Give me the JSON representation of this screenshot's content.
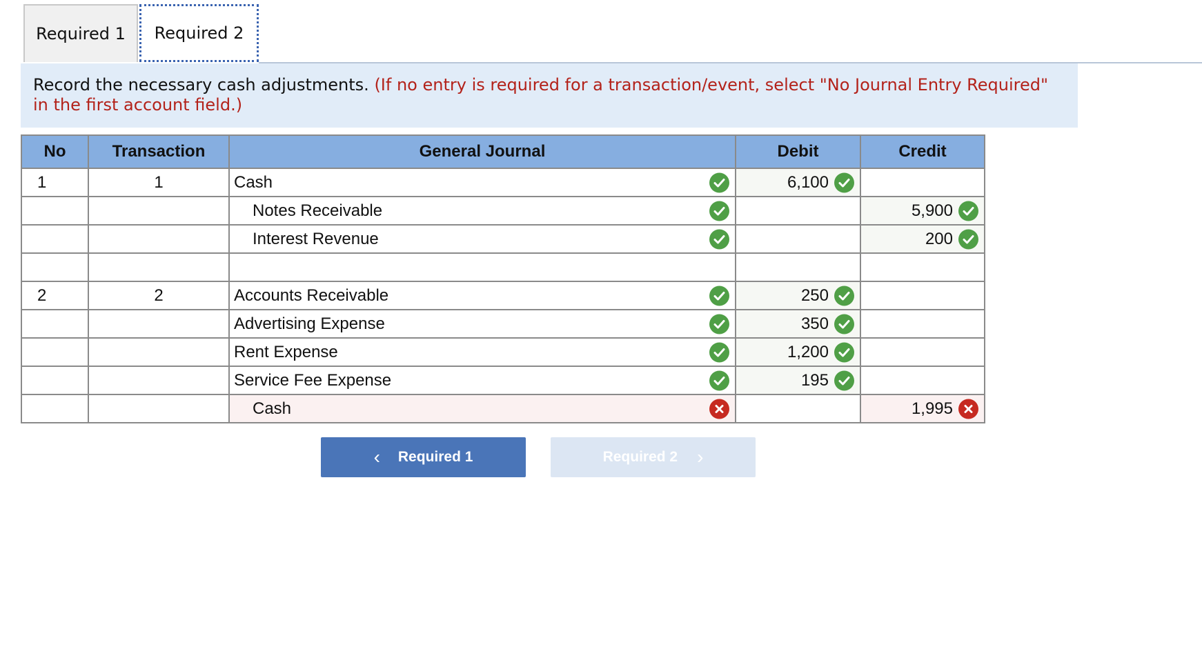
{
  "tabs": [
    {
      "label": "Required 1"
    },
    {
      "label": "Required 2"
    }
  ],
  "instructions": {
    "main": "Record the necessary cash adjustments.",
    "note": "(If no entry is required for a transaction/event, select \"No Journal Entry Required\" in the first account field.)"
  },
  "table": {
    "headers": {
      "no": "No",
      "transaction": "Transaction",
      "journal": "General Journal",
      "debit": "Debit",
      "credit": "Credit"
    },
    "rows": [
      {
        "no": "1",
        "tr": "1",
        "account": "Cash",
        "debit": "6,100",
        "credit": ""
      },
      {
        "no": "",
        "tr": "",
        "account": "Notes Receivable",
        "debit": "",
        "credit": "5,900"
      },
      {
        "no": "",
        "tr": "",
        "account": "Interest Revenue",
        "debit": "",
        "credit": "200"
      },
      {
        "no": "",
        "tr": "",
        "account": "",
        "debit": "",
        "credit": ""
      },
      {
        "no": "2",
        "tr": "2",
        "account": "Accounts Receivable",
        "debit": "250",
        "credit": ""
      },
      {
        "no": "",
        "tr": "",
        "account": "Advertising Expense",
        "debit": "350",
        "credit": ""
      },
      {
        "no": "",
        "tr": "",
        "account": "Rent Expense",
        "debit": "1,200",
        "credit": ""
      },
      {
        "no": "",
        "tr": "",
        "account": "Service Fee Expense",
        "debit": "195",
        "credit": ""
      },
      {
        "no": "",
        "tr": "",
        "account": "Cash",
        "debit": "",
        "credit": "1,995"
      }
    ]
  },
  "icons": {
    "correct": "check-circle-icon",
    "incorrect": "x-circle-icon"
  },
  "colors": {
    "header": "#86aee0",
    "correct": "#4f9f46",
    "incorrect": "#c62a21",
    "note": "#b3221a",
    "primary_button": "#4a75b8"
  },
  "nav": {
    "prev_label": "Required 1",
    "next_label": "Required 2",
    "prev_chevron": "‹",
    "next_chevron": "›"
  }
}
